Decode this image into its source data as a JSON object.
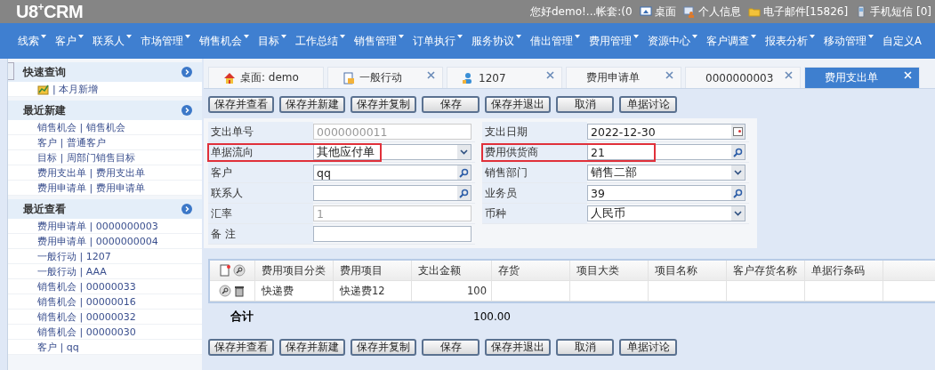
{
  "header": {
    "logo": "U8$^{+}$CRM",
    "greeting": "您好demo!...帐套:(0",
    "links": [
      {
        "kind": "desktop",
        "label": "桌面"
      },
      {
        "kind": "person",
        "label": "个人信息"
      },
      {
        "kind": "folder",
        "label": "电子邮件[15826]"
      },
      {
        "kind": "phone",
        "label": "手机短信 [0]"
      }
    ]
  },
  "nav": [
    {
      "label": "线索",
      "has_menu": true
    },
    {
      "label": "客户",
      "has_menu": true
    },
    {
      "label": "联系人",
      "has_menu": true
    },
    {
      "label": "市场管理",
      "has_menu": true
    },
    {
      "label": "销售机会",
      "has_menu": true
    },
    {
      "label": "目标",
      "has_menu": true
    },
    {
      "label": "工作总结",
      "has_menu": true
    },
    {
      "label": "销售管理",
      "has_menu": true
    },
    {
      "label": "订单执行",
      "has_menu": true
    },
    {
      "label": "服务协议",
      "has_menu": true
    },
    {
      "label": "借出管理",
      "has_menu": true
    },
    {
      "label": "费用管理",
      "has_menu": true
    },
    {
      "label": "资源中心",
      "has_menu": true
    },
    {
      "label": "客户调查",
      "has_menu": true
    },
    {
      "label": "报表分析",
      "has_menu": true
    },
    {
      "label": "移动管理",
      "has_menu": true
    },
    {
      "label": "自定义A",
      "has_menu": false
    }
  ],
  "sidebar": {
    "sections": [
      {
        "title": "快速查询",
        "items": [
          {
            "label": "| 本月新增",
            "kind": "chart"
          }
        ]
      },
      {
        "title": "最近新建",
        "items": [
          {
            "label": "销售机会 | 销售机会"
          },
          {
            "label": "客户 | 普通客户"
          },
          {
            "label": "目标 | 周部门销售目标"
          },
          {
            "label": "费用支出单 | 费用支出单"
          },
          {
            "label": "费用申请单 | 费用申请单"
          }
        ]
      },
      {
        "title": "最近查看",
        "items": [
          {
            "label": "费用申请单 | 0000000003"
          },
          {
            "label": "费用申请单 | 0000000004"
          },
          {
            "label": "一般行动 | 1207"
          },
          {
            "label": "一般行动 | AAA"
          },
          {
            "label": "销售机会 | 00000033"
          },
          {
            "label": "销售机会 | 00000016"
          },
          {
            "label": "销售机会 | 00000032"
          },
          {
            "label": "销售机会 | 00000030"
          },
          {
            "label": "客户 | qq"
          }
        ]
      }
    ]
  },
  "tabs": [
    {
      "label": "桌面: demo",
      "kind": "home",
      "closable": false,
      "selected": false
    },
    {
      "label": "一般行动",
      "kind": "document",
      "closable": true,
      "selected": false
    },
    {
      "label": "1207",
      "kind": "person",
      "closable": true,
      "selected": false
    },
    {
      "label": "费用申请单",
      "closable": true,
      "selected": false
    },
    {
      "label": "0000000003",
      "closable": true,
      "selected": false
    },
    {
      "label": "费用支出单",
      "closable": true,
      "selected": true
    }
  ],
  "toolbar_top": [
    "保存并查看",
    "保存并新建",
    "保存并复制",
    "保存",
    "保存并退出",
    "取消",
    "单据讨论"
  ],
  "form": {
    "left": [
      {
        "label": "支出单号",
        "value": "0000000011",
        "kind": "readonly",
        "highlighted": false
      },
      {
        "label": "单据流向",
        "value": "其他应付单",
        "kind": "select",
        "highlighted": true
      },
      {
        "label": "客户",
        "value": "qq",
        "kind": "lookup",
        "highlighted": false
      },
      {
        "label": "联系人",
        "kind": "lookup",
        "highlighted": false
      },
      {
        "label": "汇率",
        "value": "1",
        "kind": "readonly",
        "highlighted": false
      },
      {
        "label": "备 注",
        "kind": "text",
        "highlighted": false
      }
    ],
    "right": [
      {
        "label": "支出日期",
        "value": "2022-12-30",
        "kind": "date",
        "highlighted": false
      },
      {
        "label": "费用供货商",
        "value": "21",
        "kind": "lookup",
        "highlighted": true
      },
      {
        "label": "销售部门",
        "value": "销售二部",
        "kind": "select",
        "highlighted": false
      },
      {
        "label": "业务员",
        "value": "39",
        "kind": "lookup",
        "highlighted": false
      },
      {
        "label": "币种",
        "value": "人民币",
        "kind": "select",
        "highlighted": false
      }
    ]
  },
  "table": {
    "columns": [
      "费用项目分类",
      "费用项目",
      "支出金额",
      "存货",
      "项目大类",
      "项目名称",
      "客户存货名称",
      "单据行条码"
    ],
    "rows": [
      [
        "快递费",
        "快递费12",
        "100",
        "",
        "",
        "",
        "",
        ""
      ]
    ],
    "total": {
      "label": "合计",
      "value": "100.00"
    }
  },
  "toolbar_bottom": [
    "保存并查看",
    "保存并新建",
    "保存并复制",
    "保存",
    "保存并退出",
    "取消",
    "单据讨论"
  ]
}
